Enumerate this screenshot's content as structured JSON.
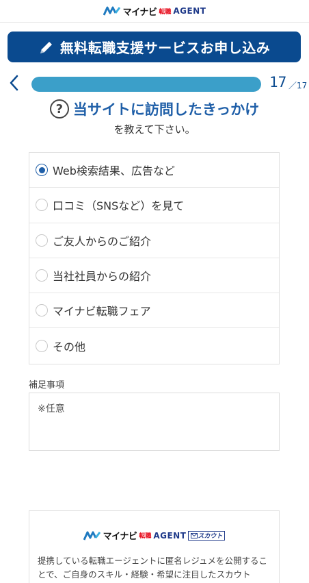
{
  "header": {
    "logo_name": "マイナビ",
    "logo_tenshoku": "転職",
    "logo_agent": "AGENT"
  },
  "banner": {
    "label": "無料転職支援サービスお申し込み",
    "icon": "pencil-icon"
  },
  "progress": {
    "current": "17",
    "total": "／17",
    "fraction": 1.0,
    "back_icon": "chevron-left-icon"
  },
  "question": {
    "icon": "question-circle-icon",
    "title": "当サイトに訪問したきっかけ",
    "subtitle": "を教えて下さい。"
  },
  "options": [
    {
      "label": "Web検索結果、広告など",
      "checked": true
    },
    {
      "label": "口コミ（SNSなど）を見て",
      "checked": false
    },
    {
      "label": "ご友人からのご紹介",
      "checked": false
    },
    {
      "label": "当社社員からの紹介",
      "checked": false
    },
    {
      "label": "マイナビ転職フェア",
      "checked": false
    },
    {
      "label": "その他",
      "checked": false
    }
  ],
  "note": {
    "label": "補足事項",
    "placeholder": "※任意"
  },
  "scout": {
    "logo_name": "マイナビ",
    "logo_tenshoku": "転職",
    "logo_agent": "AGENT",
    "badge": "スカウト",
    "text": "提携している転職エージェントに匿名レジュメを公開することで、ご自身のスキル・経験・希望に注目したスカウト"
  },
  "colors": {
    "brand_navy": "#0a4a8f",
    "accent_blue": "#1f5fa8",
    "progress": "#3b9fc9",
    "logo_red": "#e60012"
  }
}
